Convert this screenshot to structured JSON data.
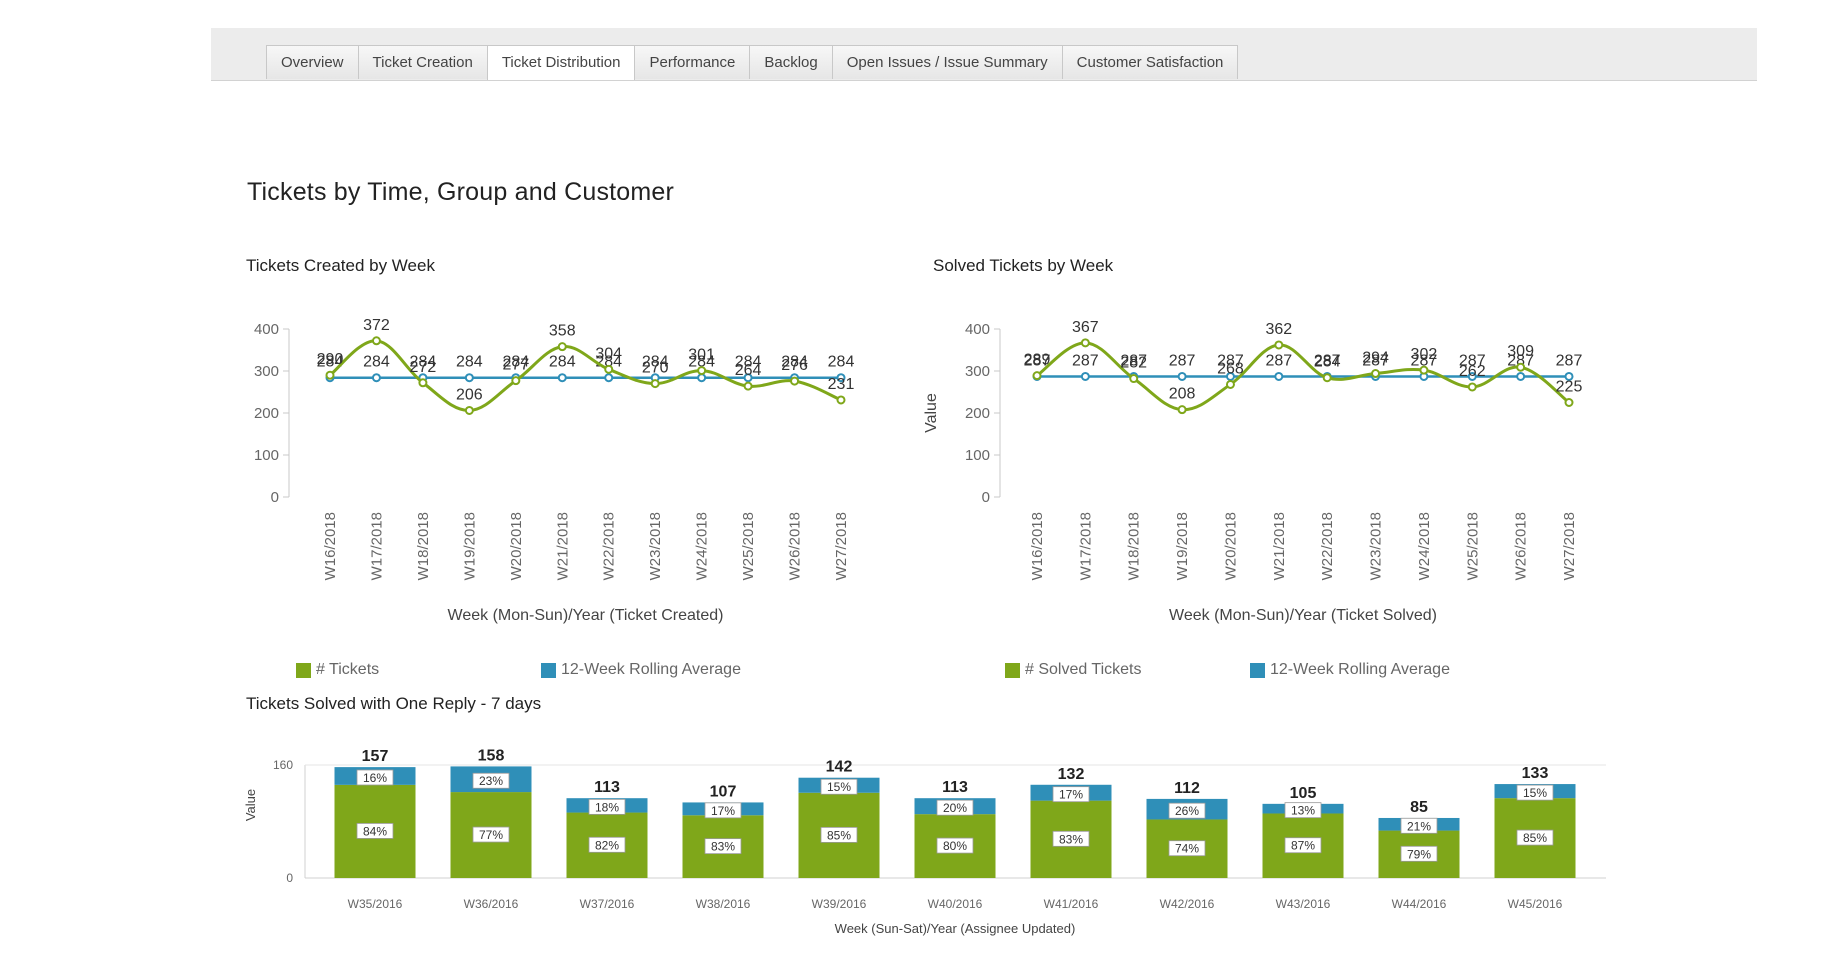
{
  "tabs": [
    {
      "label": "Overview",
      "active": false
    },
    {
      "label": "Ticket Creation",
      "active": false
    },
    {
      "label": "Ticket Distribution",
      "active": true
    },
    {
      "label": "Performance",
      "active": false
    },
    {
      "label": "Backlog",
      "active": false
    },
    {
      "label": "Open Issues / Issue Summary",
      "active": false
    },
    {
      "label": "Customer Satisfaction",
      "active": false
    }
  ],
  "page_title": "Tickets by Time, Group and Customer",
  "colors": {
    "green": "#7fa71a",
    "blue": "#2f8fb8"
  },
  "chart_data": [
    {
      "type": "line",
      "title": "Tickets Created by Week",
      "xlabel": "Week (Mon-Sun)/Year (Ticket Created)",
      "ylabel": "",
      "ylim": [
        0,
        400
      ],
      "yticks": [
        0,
        100,
        200,
        300,
        400
      ],
      "categories": [
        "W16/2018",
        "W17/2018",
        "W18/2018",
        "W19/2018",
        "W20/2018",
        "W21/2018",
        "W22/2018",
        "W23/2018",
        "W24/2018",
        "W25/2018",
        "W26/2018",
        "W27/2018"
      ],
      "series": [
        {
          "name": "# Tickets",
          "color": "#7fa71a",
          "values": [
            290,
            372,
            272,
            206,
            277,
            358,
            304,
            270,
            301,
            264,
            276,
            231
          ]
        },
        {
          "name": "12-Week Rolling Average",
          "color": "#2f8fb8",
          "values": [
            284,
            284,
            284,
            284,
            284,
            284,
            284,
            284,
            284,
            284,
            284,
            284
          ]
        }
      ],
      "legend": "bottom"
    },
    {
      "type": "line",
      "title": "Solved Tickets by Week",
      "xlabel": "Week (Mon-Sun)/Year (Ticket Solved)",
      "ylabel": "Value",
      "ylim": [
        0,
        400
      ],
      "yticks": [
        0,
        100,
        200,
        300,
        400
      ],
      "categories": [
        "W16/2018",
        "W17/2018",
        "W18/2018",
        "W19/2018",
        "W20/2018",
        "W21/2018",
        "W22/2018",
        "W23/2018",
        "W24/2018",
        "W25/2018",
        "W26/2018",
        "W27/2018"
      ],
      "series": [
        {
          "name": "# Solved Tickets",
          "color": "#7fa71a",
          "values": [
            289,
            367,
            282,
            208,
            268,
            362,
            284,
            294,
            302,
            262,
            309,
            225
          ]
        },
        {
          "name": "12-Week Rolling Average",
          "color": "#2f8fb8",
          "values": [
            287,
            287,
            287,
            287,
            287,
            287,
            287,
            287,
            287,
            287,
            287,
            287
          ]
        }
      ],
      "legend": "bottom"
    },
    {
      "type": "bar",
      "stacked": true,
      "title": "Tickets Solved with One Reply - 7 days",
      "xlabel": "Week (Sun-Sat)/Year (Assignee Updated)",
      "ylabel": "Value",
      "ylim": [
        0,
        160
      ],
      "yticks": [
        0,
        160
      ],
      "categories": [
        "W35/2016",
        "W36/2016",
        "W37/2016",
        "W38/2016",
        "W39/2016",
        "W40/2016",
        "W41/2016",
        "W42/2016",
        "W43/2016",
        "W44/2016",
        "W45/2016"
      ],
      "totals": [
        157,
        158,
        113,
        107,
        142,
        113,
        132,
        112,
        105,
        85,
        133
      ],
      "series": [
        {
          "color": "#7fa71a",
          "percent_labels": [
            "84%",
            "77%",
            "82%",
            "83%",
            "85%",
            "80%",
            "83%",
            "74%",
            "87%",
            "79%",
            "85%"
          ],
          "fractions": [
            0.84,
            0.77,
            0.82,
            0.83,
            0.85,
            0.8,
            0.83,
            0.74,
            0.87,
            0.79,
            0.85
          ]
        },
        {
          "color": "#2f8fb8",
          "percent_labels": [
            "16%",
            "23%",
            "18%",
            "17%",
            "15%",
            "20%",
            "17%",
            "26%",
            "13%",
            "21%",
            "15%"
          ],
          "fractions": [
            0.16,
            0.23,
            0.18,
            0.17,
            0.15,
            0.2,
            0.17,
            0.26,
            0.13,
            0.21,
            0.15
          ]
        }
      ]
    }
  ]
}
